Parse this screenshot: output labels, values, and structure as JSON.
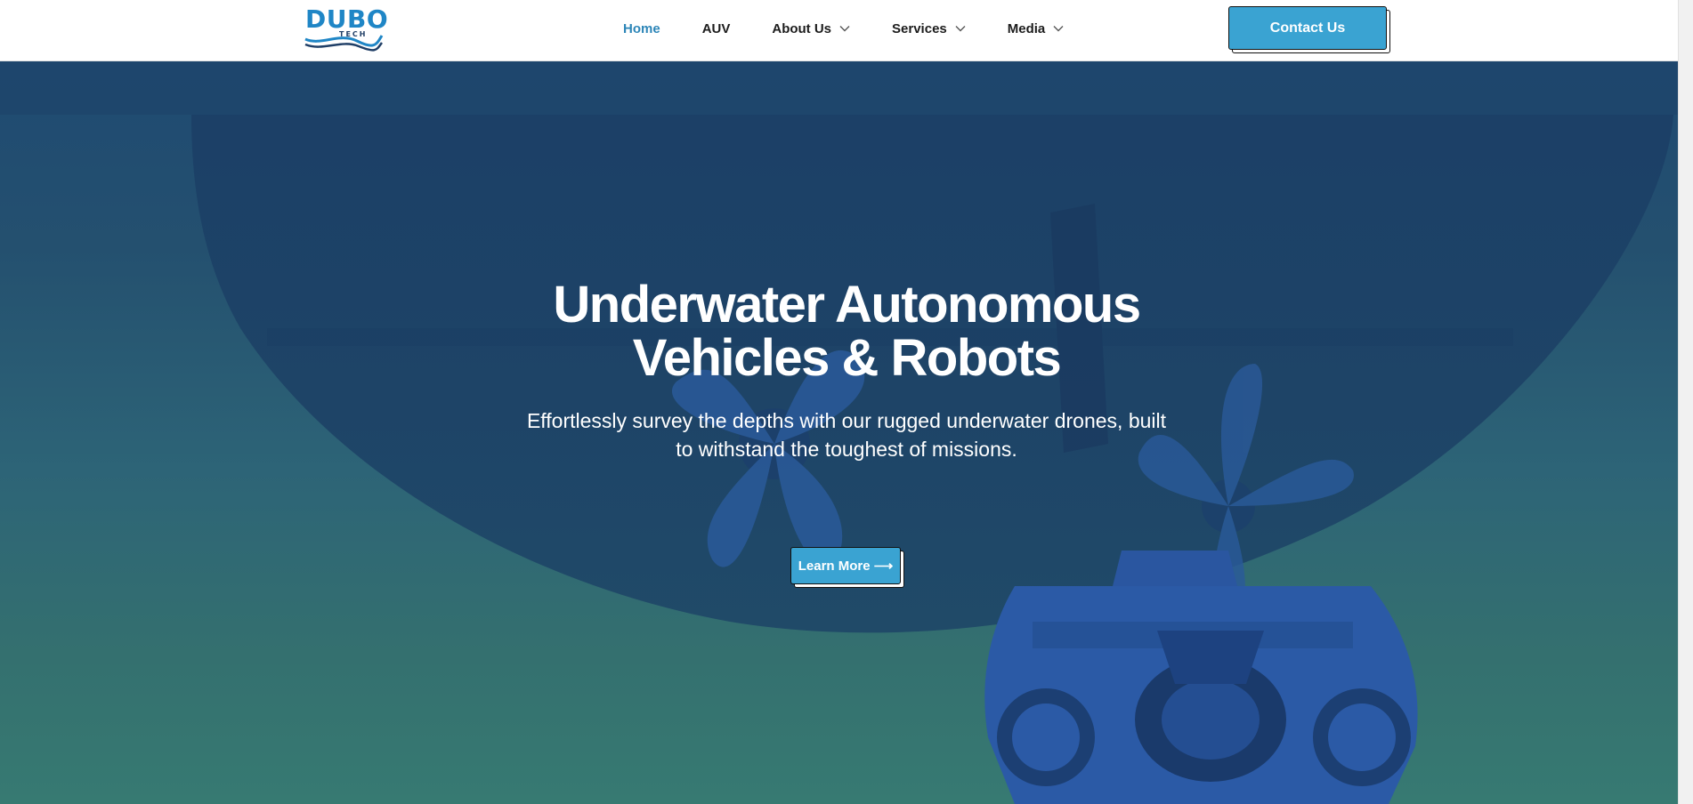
{
  "brand": {
    "logo_text": "DUBO",
    "logo_subtext": "TECH",
    "primary_color": "#1f86c6",
    "accent_color": "#3aa3d2"
  },
  "nav": {
    "items": [
      {
        "label": "Home",
        "active": true,
        "has_dropdown": false
      },
      {
        "label": "AUV",
        "active": false,
        "has_dropdown": false
      },
      {
        "label": "About Us",
        "active": false,
        "has_dropdown": true
      },
      {
        "label": "Services",
        "active": false,
        "has_dropdown": true
      },
      {
        "label": "Media",
        "active": false,
        "has_dropdown": true
      }
    ],
    "contact_label": "Contact Us"
  },
  "hero": {
    "title_line1": "Underwater Autonomous",
    "title_line2": "Vehicles & Robots",
    "subtitle_line1": "Effortlessly survey the depths with our rugged underwater drones, built",
    "subtitle_line2": "to withstand the toughest of missions.",
    "cta_label": "Learn More ⟶",
    "background_color": "#24506f"
  }
}
